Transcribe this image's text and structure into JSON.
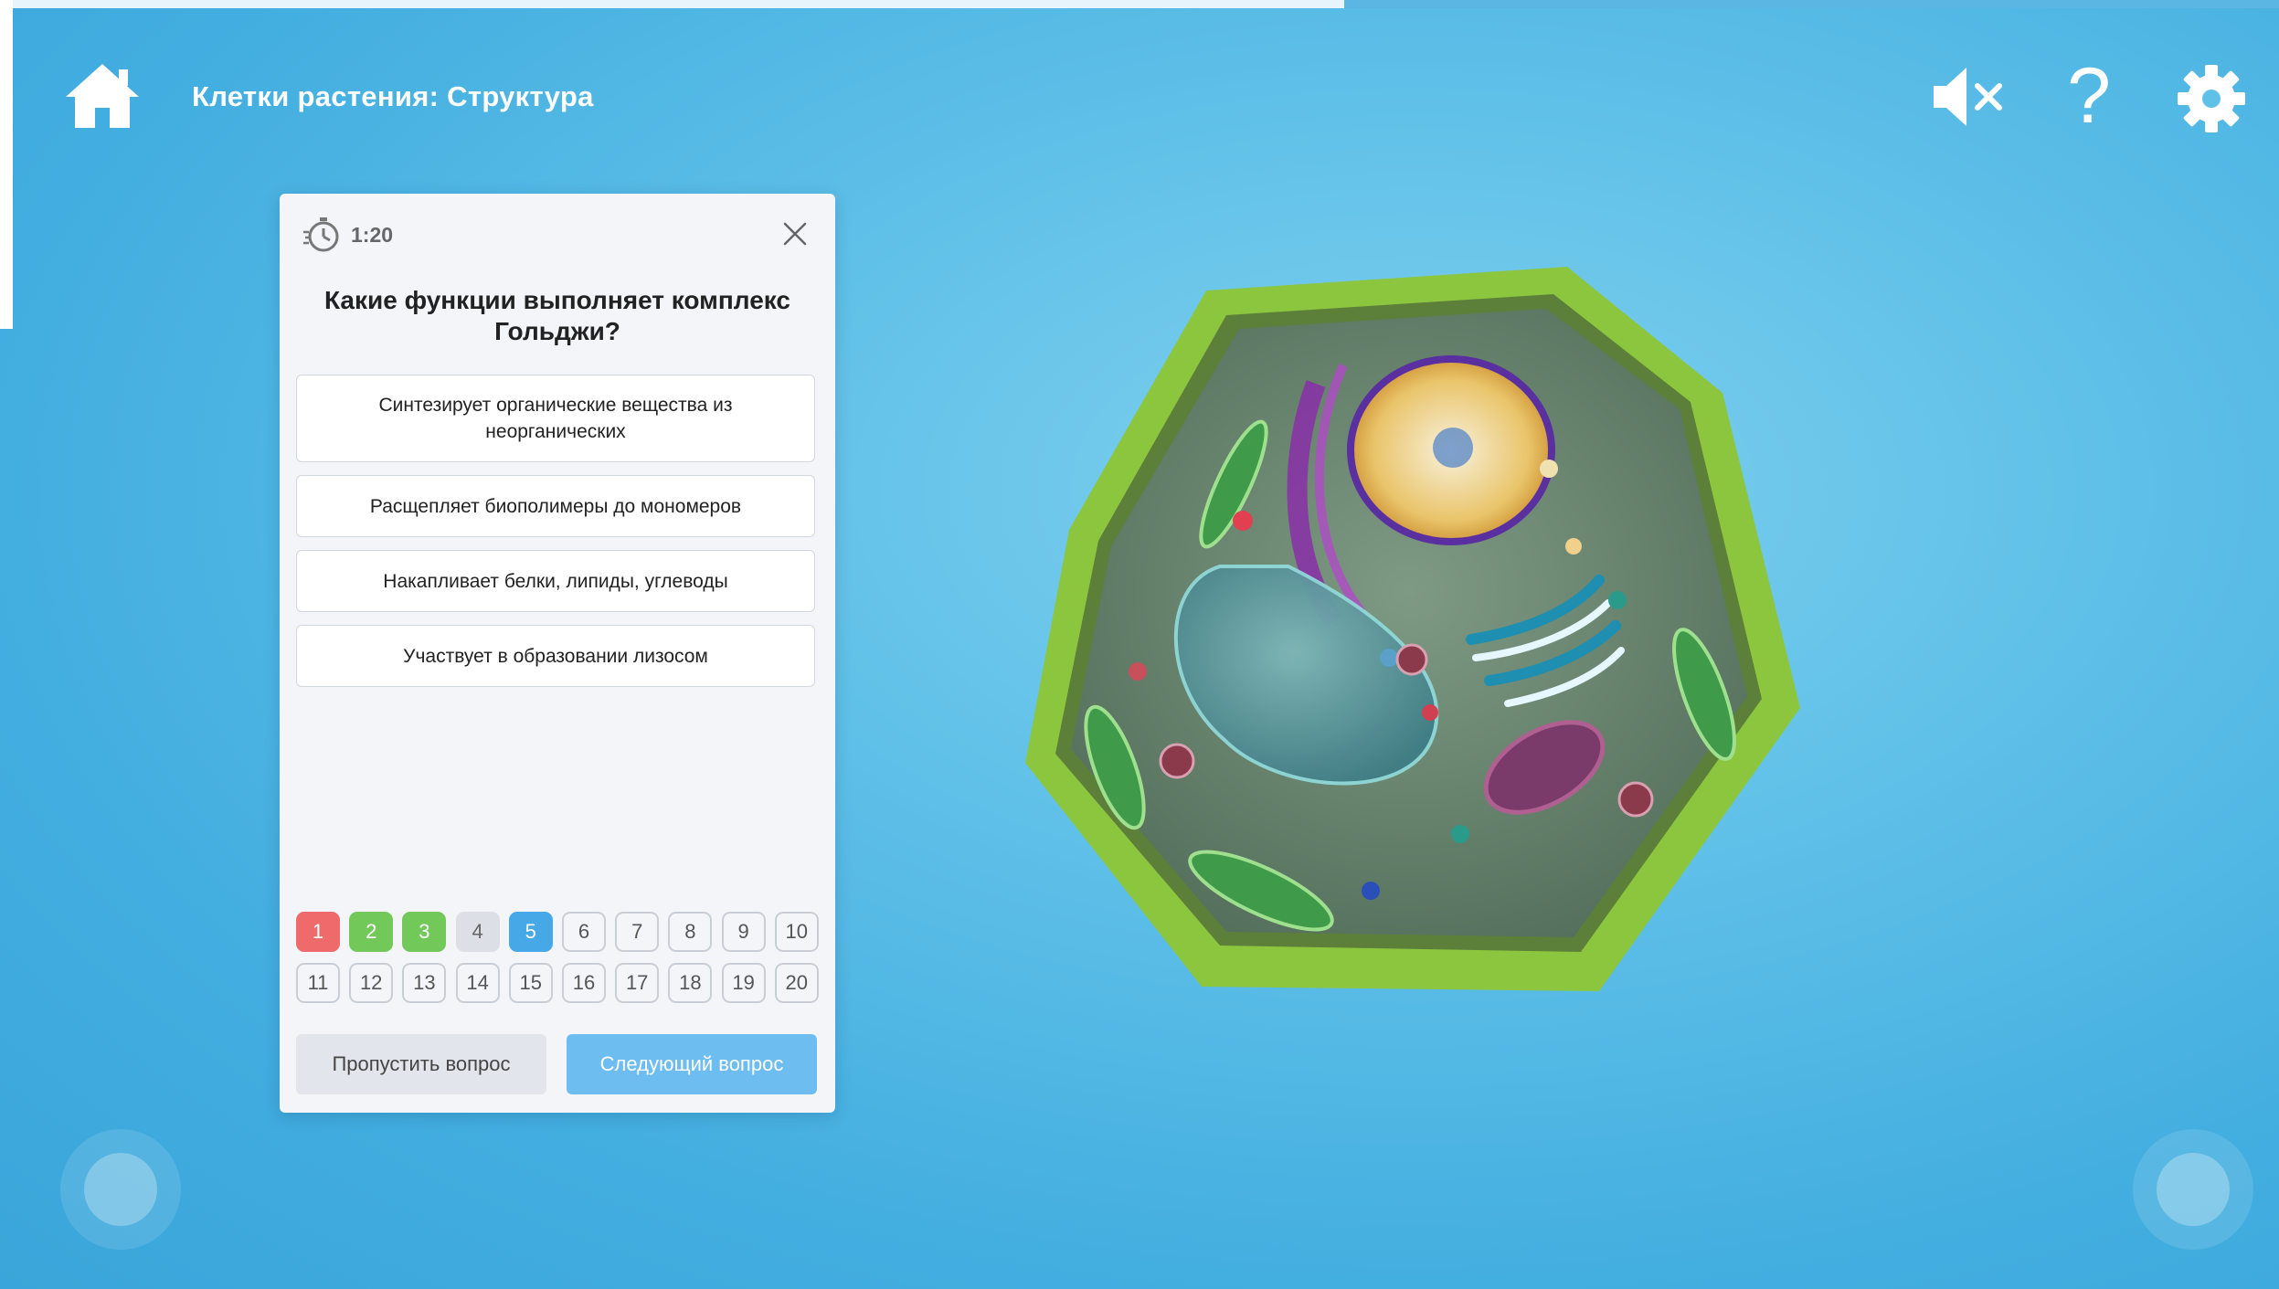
{
  "header": {
    "title": "Клетки растения: Структура",
    "progress_fraction": 0.59
  },
  "toolbar": {
    "home_icon": "home-icon",
    "mute_icon": "speaker-muted-icon",
    "help_label": "?",
    "settings_icon": "gear-icon"
  },
  "quiz": {
    "timer": "1:20",
    "question": "Какие функции выполняет комплекс Гольджи?",
    "answers": [
      "Синтезирует органические вещества из неорганических",
      "Расщепляет биополимеры до мономеров",
      "Накапливает белки, липиды, углеводы",
      "Участвует в образовании лизосом"
    ],
    "question_numbers": [
      {
        "label": "1",
        "state": "wrong"
      },
      {
        "label": "2",
        "state": "right"
      },
      {
        "label": "3",
        "state": "right"
      },
      {
        "label": "4",
        "state": "skipped"
      },
      {
        "label": "5",
        "state": "current"
      },
      {
        "label": "6",
        "state": "pending"
      },
      {
        "label": "7",
        "state": "pending"
      },
      {
        "label": "8",
        "state": "pending"
      },
      {
        "label": "9",
        "state": "pending"
      },
      {
        "label": "10",
        "state": "pending"
      },
      {
        "label": "11",
        "state": "pending"
      },
      {
        "label": "12",
        "state": "pending"
      },
      {
        "label": "13",
        "state": "pending"
      },
      {
        "label": "14",
        "state": "pending"
      },
      {
        "label": "15",
        "state": "pending"
      },
      {
        "label": "16",
        "state": "pending"
      },
      {
        "label": "17",
        "state": "pending"
      },
      {
        "label": "18",
        "state": "pending"
      },
      {
        "label": "19",
        "state": "pending"
      },
      {
        "label": "20",
        "state": "pending"
      }
    ],
    "skip_label": "Пропустить вопрос",
    "next_label": "Следующий вопрос"
  },
  "colors": {
    "wrong": "#ef6a6a",
    "right": "#72c95a",
    "current": "#46a8e6",
    "accent": "#6ebdf0"
  }
}
